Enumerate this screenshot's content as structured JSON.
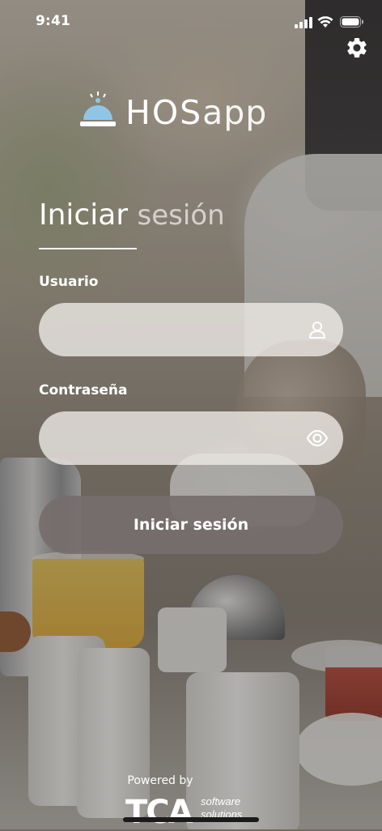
{
  "status_bar": {
    "time": "9:41",
    "signal_icon": "cellular-signal-icon",
    "wifi_icon": "wifi-icon",
    "battery_icon": "battery-icon"
  },
  "settings": {
    "icon": "gear-icon"
  },
  "logo": {
    "icon": "service-bell-icon",
    "text_bold": "HOS",
    "text_light": "app"
  },
  "login": {
    "title_bold": "Iniciar",
    "title_light": "sesión",
    "username_label": "Usuario",
    "username_value": "",
    "username_icon": "user-icon",
    "password_label": "Contraseña",
    "password_value": "",
    "password_icon": "eye-icon",
    "submit_label": "Iniciar sesión"
  },
  "footer": {
    "powered_by": "Powered by",
    "brand": "TCA",
    "brand_line1": "software",
    "brand_line2": "solutions"
  },
  "colors": {
    "button": "#766e6c",
    "field": "#f0ece8",
    "text": "#ffffff"
  }
}
